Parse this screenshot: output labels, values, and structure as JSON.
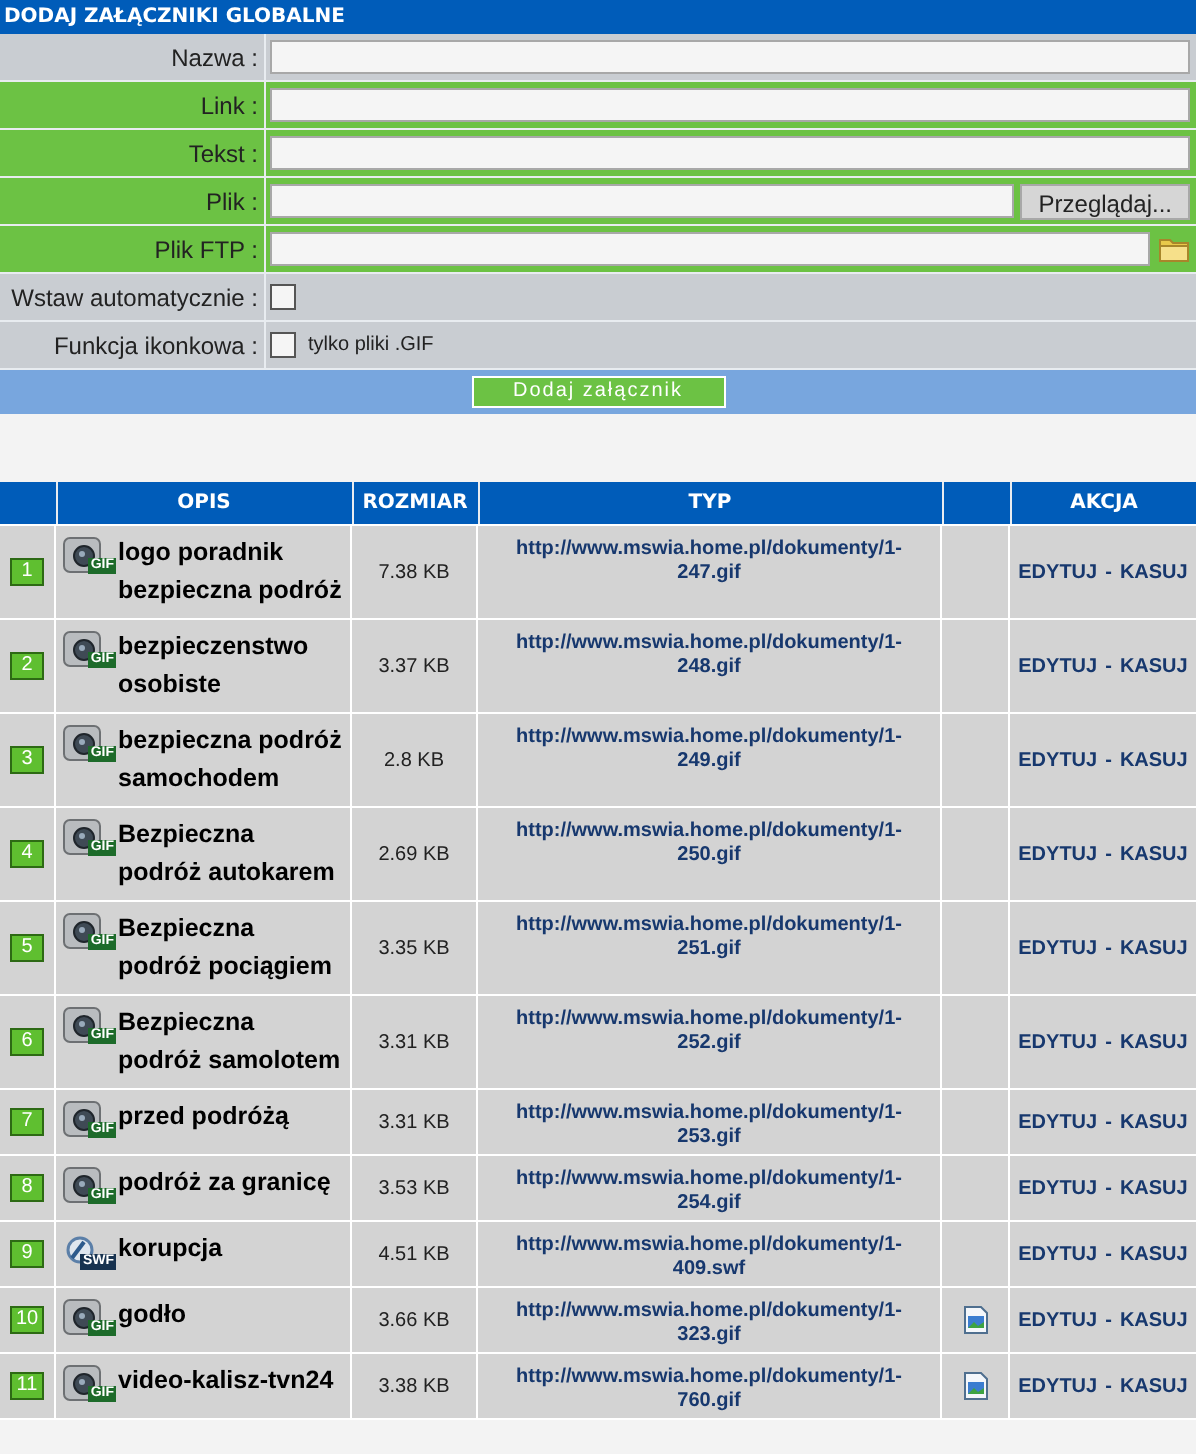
{
  "form": {
    "title": "DODAJ ZAŁĄCZNIKI GLOBALNE",
    "fields": [
      {
        "kind": "text",
        "label": "Nazwa :",
        "highlighted": false
      },
      {
        "kind": "text",
        "label": "Link :",
        "highlighted": true
      },
      {
        "kind": "text",
        "label": "Tekst :",
        "highlighted": true
      },
      {
        "kind": "file",
        "label": "Plik :",
        "highlighted": true,
        "button": "Przeglądaj..."
      },
      {
        "kind": "ftp",
        "label": "Plik FTP :",
        "highlighted": true
      },
      {
        "kind": "checkbox",
        "label": "Wstaw automatycznie :",
        "highlighted": false,
        "checked": false
      },
      {
        "kind": "checkbox",
        "label": "Funkcja ikonkowa :",
        "highlighted": false,
        "checked": false,
        "hint": "tylko pliki .GIF"
      }
    ],
    "submit": "Dodaj załącznik"
  },
  "table": {
    "columns": [
      "OPIS",
      "ROZMIAR",
      "TYP",
      "AKCJA"
    ],
    "rows": [
      {
        "number": "1",
        "icon": {
          "kind": "camera",
          "badge": "GIF"
        },
        "name": "logo poradnik bezpieczna podróż",
        "size": "7.38 KB",
        "link": "http://www.mswia.home.pl/dokumenty/1-247.gif",
        "preview": false,
        "edit": "EDYTUJ",
        "separator": "-",
        "delete": "KASUJ"
      },
      {
        "number": "2",
        "icon": {
          "kind": "camera",
          "badge": "GIF"
        },
        "name": "bezpieczenstwo osobiste",
        "size": "3.37 KB",
        "link": "http://www.mswia.home.pl/dokumenty/1-248.gif",
        "preview": false,
        "edit": "EDYTUJ",
        "separator": "-",
        "delete": "KASUJ"
      },
      {
        "number": "3",
        "icon": {
          "kind": "camera",
          "badge": "GIF"
        },
        "name": "bezpieczna podróż samochodem",
        "size": "2.8 KB",
        "link": "http://www.mswia.home.pl/dokumenty/1-249.gif",
        "preview": false,
        "edit": "EDYTUJ",
        "separator": "-",
        "delete": "KASUJ"
      },
      {
        "number": "4",
        "icon": {
          "kind": "camera",
          "badge": "GIF"
        },
        "name": "Bezpieczna podróż autokarem",
        "size": "2.69 KB",
        "link": "http://www.mswia.home.pl/dokumenty/1-250.gif",
        "preview": false,
        "edit": "EDYTUJ",
        "separator": "-",
        "delete": "KASUJ"
      },
      {
        "number": "5",
        "icon": {
          "kind": "camera",
          "badge": "GIF"
        },
        "name": "Bezpieczna podróż pociągiem",
        "size": "3.35 KB",
        "link": "http://www.mswia.home.pl/dokumenty/1-251.gif",
        "preview": false,
        "edit": "EDYTUJ",
        "separator": "-",
        "delete": "KASUJ"
      },
      {
        "number": "6",
        "icon": {
          "kind": "camera",
          "badge": "GIF"
        },
        "name": "Bezpieczna podróż samolotem",
        "size": "3.31 KB",
        "link": "http://www.mswia.home.pl/dokumenty/1-252.gif",
        "preview": false,
        "edit": "EDYTUJ",
        "separator": "-",
        "delete": "KASUJ"
      },
      {
        "number": "7",
        "icon": {
          "kind": "camera",
          "badge": "GIF"
        },
        "name": "przed podróżą",
        "size": "3.31 KB",
        "link": "http://www.mswia.home.pl/dokumenty/1-253.gif",
        "preview": false,
        "edit": "EDYTUJ",
        "separator": "-",
        "delete": "KASUJ"
      },
      {
        "number": "8",
        "icon": {
          "kind": "camera",
          "badge": "GIF"
        },
        "name": "podróż za granicę",
        "size": "3.53 KB",
        "link": "http://www.mswia.home.pl/dokumenty/1-254.gif",
        "preview": false,
        "edit": "EDYTUJ",
        "separator": "-",
        "delete": "KASUJ"
      },
      {
        "number": "9",
        "icon": {
          "kind": "flash",
          "badge": "SWF"
        },
        "name": "korupcja",
        "size": "4.51 KB",
        "link": "http://www.mswia.home.pl/dokumenty/1-409.swf",
        "preview": false,
        "edit": "EDYTUJ",
        "separator": "-",
        "delete": "KASUJ"
      },
      {
        "number": "10",
        "icon": {
          "kind": "camera",
          "badge": "GIF"
        },
        "name": "godło",
        "size": "3.66 KB",
        "link": "http://www.mswia.home.pl/dokumenty/1-323.gif",
        "preview": true,
        "edit": "EDYTUJ",
        "separator": "-",
        "delete": "KASUJ"
      },
      {
        "number": "11",
        "icon": {
          "kind": "camera",
          "badge": "GIF"
        },
        "name": "video-kalisz-tvn24",
        "size": "3.38 KB",
        "link": "http://www.mswia.home.pl/dokumenty/1-760.gif",
        "preview": true,
        "edit": "EDYTUJ",
        "separator": "-",
        "delete": "KASUJ"
      }
    ]
  }
}
